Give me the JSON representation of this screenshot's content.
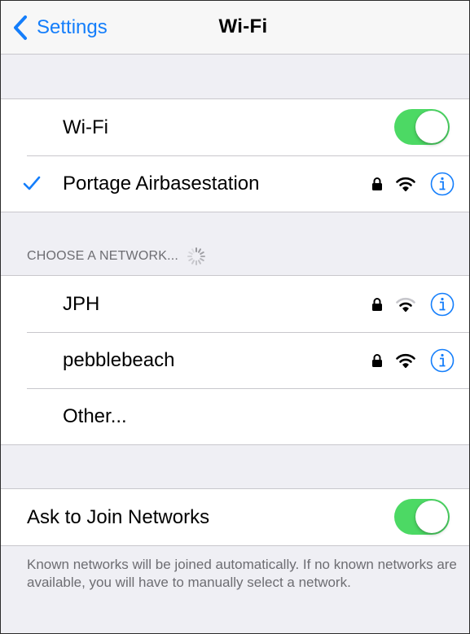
{
  "nav": {
    "back_label": "Settings",
    "title": "Wi-Fi"
  },
  "wifi_toggle": {
    "label": "Wi-Fi",
    "state": "on"
  },
  "connected_network": {
    "name": "Portage Airbasestation",
    "secured": true,
    "signal": "full"
  },
  "section_header": "CHOOSE A NETWORK...",
  "networks": [
    {
      "name": "JPH",
      "secured": true,
      "signal": "partial"
    },
    {
      "name": "pebblebeach",
      "secured": true,
      "signal": "full"
    }
  ],
  "other_label": "Other...",
  "ask_to_join": {
    "label": "Ask to Join Networks",
    "state": "on"
  },
  "footer": "Known networks will be joined automatically. If no known networks are available, you will have to manually select a network.",
  "colors": {
    "accent": "#147efb",
    "toggle_on": "#4cd964",
    "background": "#efeff4",
    "separator": "#c8c7cc",
    "secondary_text": "#6d6d72"
  },
  "icons": [
    "chevron-left-icon",
    "checkmark-icon",
    "lock-icon",
    "wifi-icon",
    "info-icon",
    "spinner-icon"
  ]
}
